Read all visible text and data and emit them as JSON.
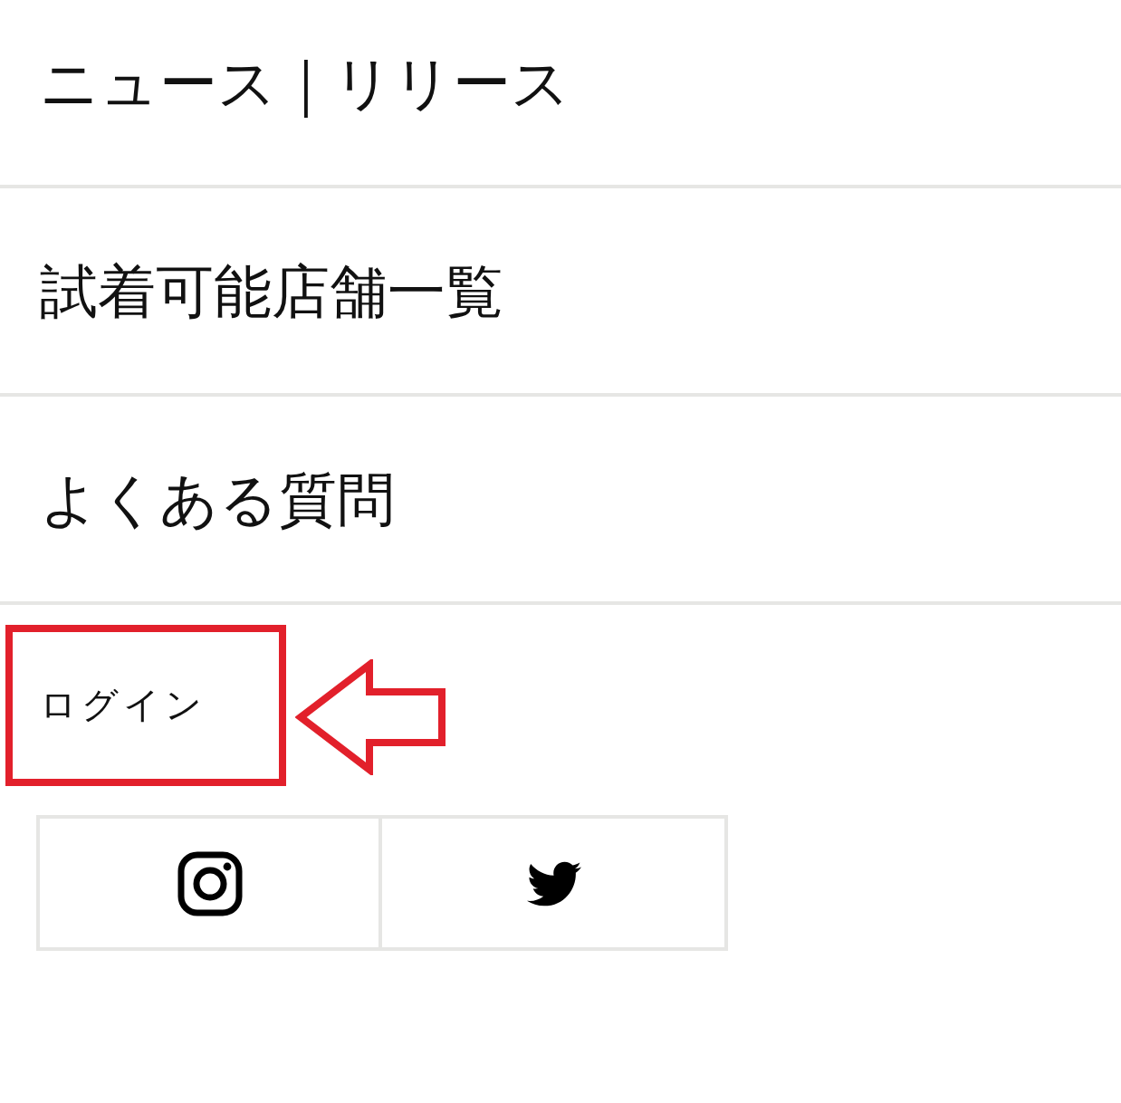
{
  "menu_items": [
    {
      "label": "ニュース｜リリース"
    },
    {
      "label": "試着可能店舗一覧"
    },
    {
      "label": "よくある質問"
    }
  ],
  "login": {
    "label": "ログイン",
    "highlighted": true
  }
}
